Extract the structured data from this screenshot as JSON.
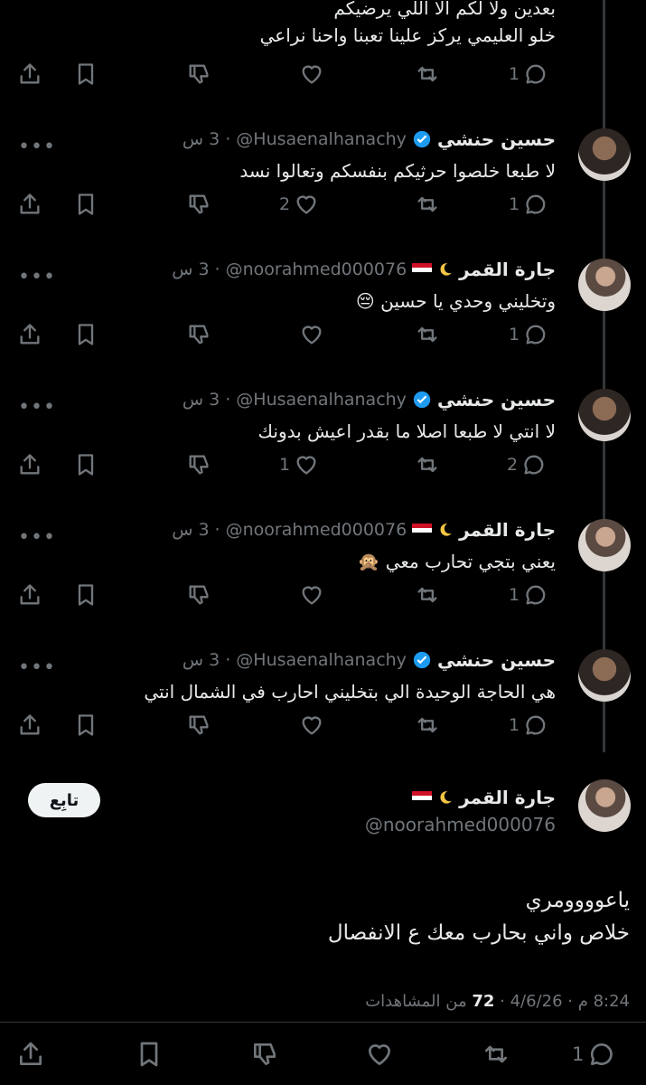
{
  "top": {
    "line1": "بعدين ولا لكم الا اللي يرضيكم",
    "line2": "خلو العليمي يركز علينا تعبنا واحنا نراعي",
    "reply_count": "1"
  },
  "replies": [
    {
      "name": "حسين حنشي",
      "handle": "@Husaenalhanachy",
      "time": "3 س",
      "text": "لا طبعا خلصوا حرثيكم بنفسكم وتعالوا نسد",
      "reply_count": "1",
      "like_count": "2"
    },
    {
      "name": "جارة القمر",
      "handle": "@noorahmed000076",
      "time": "3 س",
      "text": "وتخليني وحدي يا حسين 😔",
      "reply_count": "1",
      "like_count": ""
    },
    {
      "name": "حسين حنشي",
      "handle": "@Husaenalhanachy",
      "time": "3 س",
      "text": "لا انتي لا طبعا اصلا ما بقدر اعيش بدونك",
      "reply_count": "2",
      "like_count": "1"
    },
    {
      "name": "جارة القمر",
      "handle": "@noorahmed000076",
      "time": "3 س",
      "text": "يعني بتجي تحارب معي 🙊",
      "reply_count": "1",
      "like_count": ""
    },
    {
      "name": "حسين حنشي",
      "handle": "@Husaenalhanachy",
      "time": "3 س",
      "text": "هي الحاجة الوحيدة الي بتخليني احارب في الشمال انتي",
      "reply_count": "1",
      "like_count": ""
    }
  ],
  "main": {
    "name": "جارة القمر",
    "handle": "@noorahmed000076",
    "follow_label": "تابِع",
    "line1": "ياعوووومري",
    "line2": "خلاص واني بحارب معك ع الانفصال",
    "date": "4/6/26",
    "time": "8:24 م",
    "views_count": "72",
    "views_label": "من المشاهدات",
    "reply_count": "1"
  },
  "icons": [
    "share-icon",
    "bookmark-icon",
    "dislike-icon",
    "like-icon",
    "retweet-icon",
    "reply-icon",
    "verified-icon",
    "moon-icon",
    "egypt-flag-icon",
    "more-icon"
  ],
  "colors": {
    "background": "#000000",
    "text": "#e7e9ea",
    "muted": "#71767b",
    "verified": "#1d9bf0",
    "button": "#eff3f4"
  }
}
